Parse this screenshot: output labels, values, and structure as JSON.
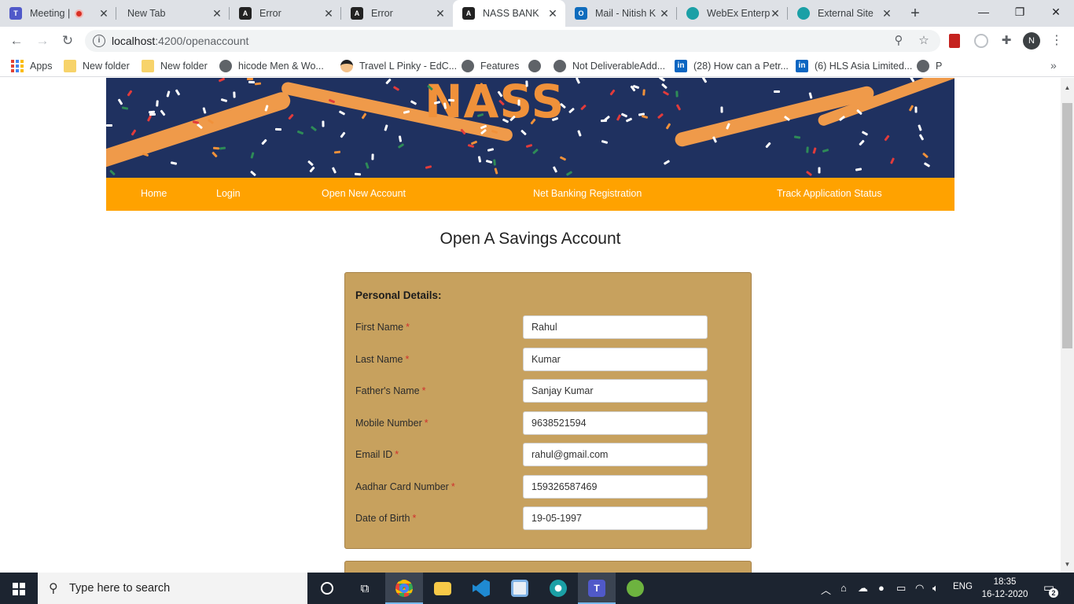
{
  "browser": {
    "tabs": [
      {
        "title": "Meeting |",
        "favicon": "teams-icon",
        "recording": true
      },
      {
        "title": "New Tab",
        "favicon": "blank-icon"
      },
      {
        "title": "Error",
        "favicon": "angular-icon"
      },
      {
        "title": "Error",
        "favicon": "angular-icon"
      },
      {
        "title": "NASS BANK",
        "favicon": "angular-icon",
        "active": true
      },
      {
        "title": "Mail - Nitish K",
        "favicon": "outlook-icon"
      },
      {
        "title": "WebEx Enterpr",
        "favicon": "webex-icon"
      },
      {
        "title": "External Site",
        "favicon": "webex-icon"
      }
    ],
    "url_host": "localhost",
    "url_path": ":4200/openaccount",
    "profile_initial": "N",
    "bookmarks": [
      {
        "label": "Apps",
        "icon": "apps-icon"
      },
      {
        "label": "New folder",
        "icon": "folder-icon"
      },
      {
        "label": "New folder",
        "icon": "folder-icon"
      },
      {
        "label": "hicode Men & Wo...",
        "icon": "globe-icon"
      },
      {
        "label": "Travel L Pinky - EdC...",
        "icon": "avatar-icon"
      },
      {
        "label": "Features",
        "icon": "globe-icon"
      },
      {
        "label": "",
        "icon": "globe-icon"
      },
      {
        "label": "Not DeliverableAdd...",
        "icon": "globe-icon"
      },
      {
        "label": "(28) How can a Petr...",
        "icon": "linkedin-icon"
      },
      {
        "label": "(6) HLS Asia Limited...",
        "icon": "linkedin-icon"
      },
      {
        "label": "P",
        "icon": "globe-icon"
      }
    ]
  },
  "site": {
    "brand": "NASS",
    "nav": [
      "Home",
      "Login",
      "Open New Account",
      "Net Banking Registration",
      "Track Application Status"
    ],
    "page_title": "Open A Savings Account",
    "section_title": "Personal Details:",
    "fields": [
      {
        "label": "First Name",
        "value": "Rahul"
      },
      {
        "label": "Last Name",
        "value": "Kumar"
      },
      {
        "label": "Father's Name",
        "value": "Sanjay Kumar"
      },
      {
        "label": "Mobile Number",
        "value": "9638521594"
      },
      {
        "label": "Email ID",
        "value": "rahul@gmail.com"
      },
      {
        "label": "Aadhar Card Number",
        "value": "159326587469"
      },
      {
        "label": "Date of Birth",
        "value": "19-05-1997"
      }
    ],
    "required_mark": "*"
  },
  "taskbar": {
    "search_placeholder": "Type here to search",
    "language": "ENG",
    "time": "18:35",
    "date": "16-12-2020",
    "notifications": "2"
  },
  "colors": {
    "nav_bg": "#ffa200",
    "form_bg": "#c7a15e",
    "banner_bg": "#1f3160",
    "brand": "#f0913a"
  }
}
